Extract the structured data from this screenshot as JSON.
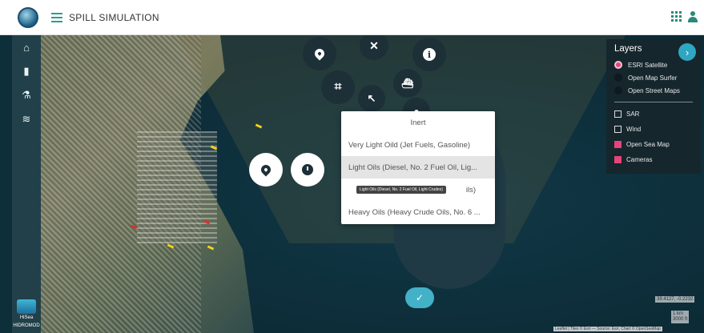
{
  "header": {
    "title": "SPILL SIMULATION",
    "logo_icon": "globe-logo",
    "right_icons": [
      "apps-grid-icon",
      "user-icon"
    ]
  },
  "sidebar": {
    "items": [
      {
        "icon": "home-icon"
      },
      {
        "icon": "fuel-icon"
      },
      {
        "icon": "flask-icon"
      },
      {
        "icon": "waves-icon"
      }
    ],
    "footer_label": "HiSea",
    "footer_text": "HIDROMOD"
  },
  "radial_menu": {
    "buttons": [
      "location-pin-icon",
      "close-icon",
      "info-icon",
      "polygon-icon",
      "undo-icon",
      "ship-icon",
      "oil-drop-icon",
      "location-pin-icon",
      "clock-icon",
      "check-icon"
    ],
    "close_glyph": "✕",
    "info_glyph": "i",
    "check_glyph": "✓"
  },
  "oil_dropdown": {
    "options": [
      "Inert",
      "Very Light Oild (Jet Fuels, Gasoline)",
      "Light Oils (Diesel, No. 2 Fuel Oil, Lig...",
      "Medium Oils",
      "Heavy Oils (Heavy Crude Oils, No. 6 ..."
    ],
    "selected_index": 2,
    "tooltip": "Light Oils (Diesel, No. 2 Fuel Oil, Light Crudes)",
    "partial_visible_suffix": "ils)"
  },
  "layers_panel": {
    "title": "Layers",
    "next_glyph": "›",
    "base_layers": [
      {
        "label": "ESRI Satellite",
        "selected": true
      },
      {
        "label": "Open Map Surfer",
        "selected": false
      },
      {
        "label": "Open Street Maps",
        "selected": false
      }
    ],
    "overlays": [
      {
        "label": "SAR",
        "checked": false
      },
      {
        "label": "Wind",
        "checked": false
      },
      {
        "label": "Open Sea Map",
        "checked": true
      },
      {
        "label": "Cameras",
        "checked": true
      }
    ]
  },
  "map": {
    "coordinates": "39.4127, -0.2232",
    "scale_km": "1 km",
    "scale_ft": "3000 ft",
    "attribution": "Leaflet | Tiles © Esri — Source: Esri, Chart © OpenSeaMap"
  },
  "colors": {
    "accent": "#2fa6c2",
    "checked": "#e8447a",
    "header_icon": "#2a8a7a"
  }
}
